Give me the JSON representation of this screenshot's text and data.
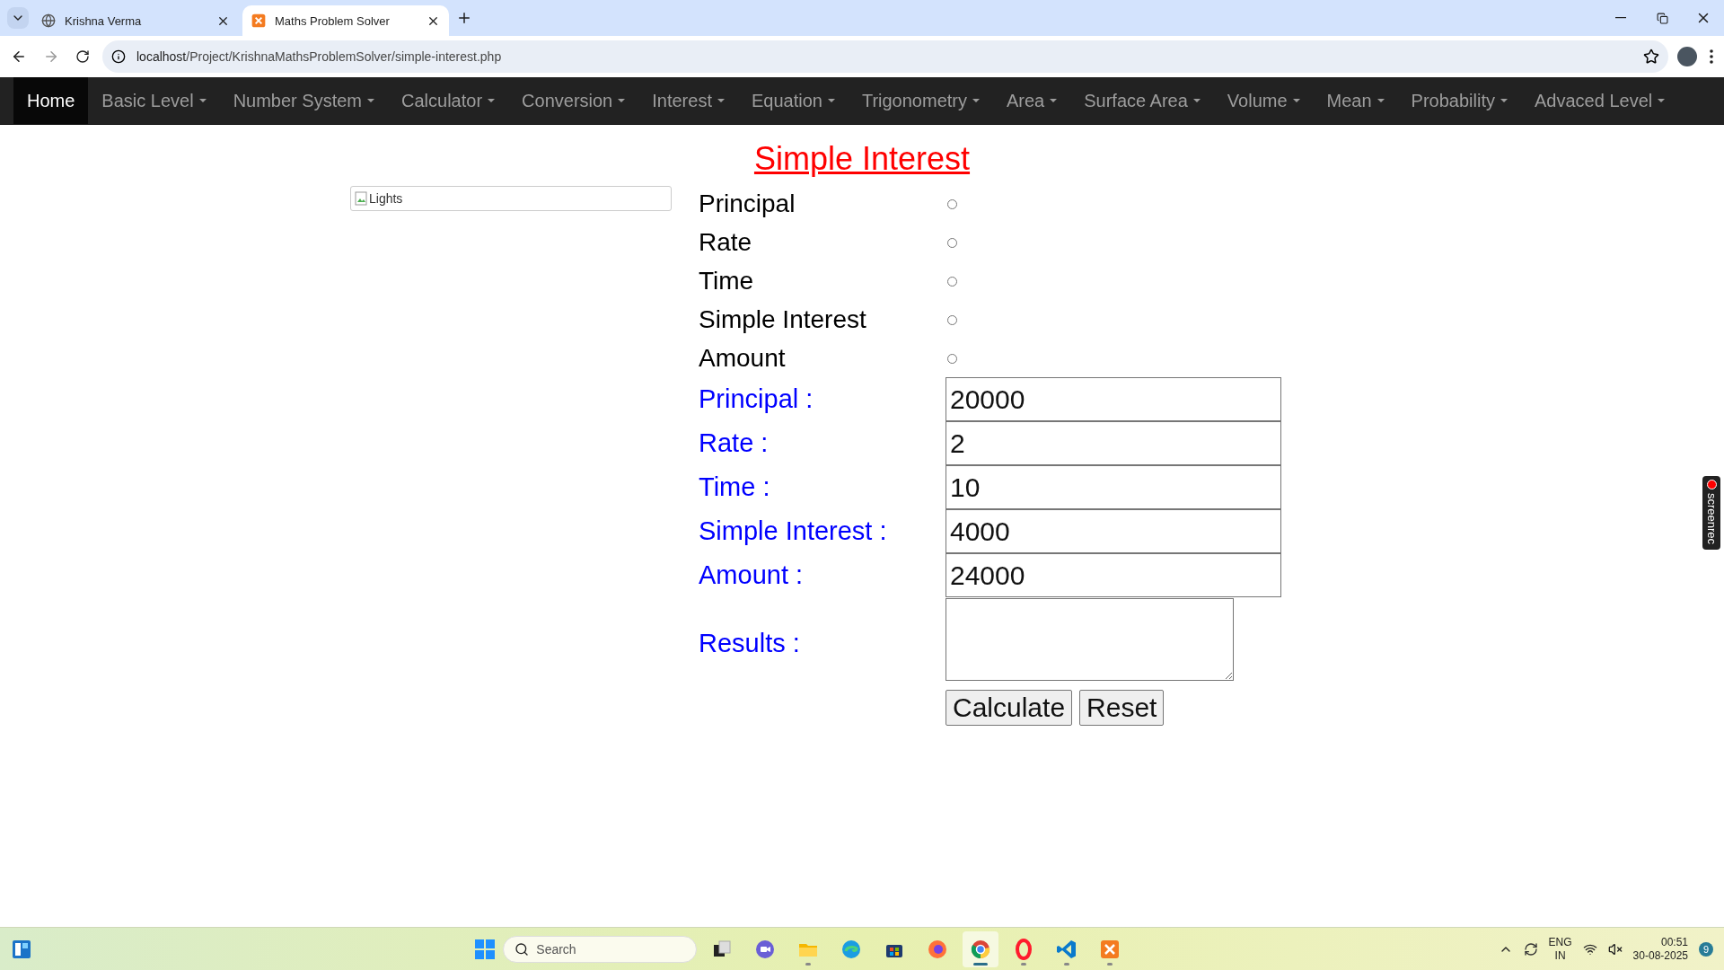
{
  "browser": {
    "tabs": [
      {
        "title": "Krishna Verma",
        "selected": false
      },
      {
        "title": "Maths Problem Solver",
        "selected": true
      }
    ],
    "url": {
      "host": "localhost",
      "path": "/Project/KrishnaMathsProblemSolver/simple-interest.php"
    }
  },
  "nav": {
    "items": [
      {
        "label": "Home",
        "selected": true,
        "dropdown": false
      },
      {
        "label": "Basic Level",
        "selected": false,
        "dropdown": true
      },
      {
        "label": "Number System",
        "selected": false,
        "dropdown": true
      },
      {
        "label": "Calculator",
        "selected": false,
        "dropdown": true
      },
      {
        "label": "Conversion",
        "selected": false,
        "dropdown": true
      },
      {
        "label": "Interest",
        "selected": false,
        "dropdown": true
      },
      {
        "label": "Equation",
        "selected": false,
        "dropdown": true
      },
      {
        "label": "Trigonometry",
        "selected": false,
        "dropdown": true
      },
      {
        "label": "Area",
        "selected": false,
        "dropdown": true
      },
      {
        "label": "Surface Area",
        "selected": false,
        "dropdown": true
      },
      {
        "label": "Volume",
        "selected": false,
        "dropdown": true
      },
      {
        "label": "Mean",
        "selected": false,
        "dropdown": true
      },
      {
        "label": "Probability",
        "selected": false,
        "dropdown": true
      },
      {
        "label": "Advaced Level",
        "selected": false,
        "dropdown": true
      }
    ]
  },
  "page": {
    "title": "Simple Interest",
    "image_alt": "Lights",
    "radios": [
      {
        "label": "Principal",
        "selected": false
      },
      {
        "label": "Rate",
        "selected": false
      },
      {
        "label": "Time",
        "selected": false
      },
      {
        "label": "Simple Interest",
        "selected": false
      },
      {
        "label": "Amount",
        "selected": false
      }
    ],
    "fields": [
      {
        "label": "Principal :",
        "value": "20000"
      },
      {
        "label": "Rate :",
        "value": "2"
      },
      {
        "label": "Time :",
        "value": "10"
      },
      {
        "label": "Simple Interest :",
        "value": "4000"
      },
      {
        "label": "Amount :",
        "value": "24000"
      }
    ],
    "results": {
      "label": "Results :"
    },
    "buttons": [
      "Calculate",
      "Reset"
    ]
  },
  "screenrec": {
    "label": "screenrec"
  },
  "taskbar": {
    "search": {
      "placeholder": "Search"
    },
    "apps": [
      {
        "kind": "taskview",
        "running": false,
        "active": false
      },
      {
        "kind": "meet",
        "running": false,
        "active": false
      },
      {
        "kind": "explorer",
        "running": true,
        "active": false
      },
      {
        "kind": "edge",
        "running": false,
        "active": false
      },
      {
        "kind": "store",
        "running": false,
        "active": false
      },
      {
        "kind": "firefox",
        "running": false,
        "active": false
      },
      {
        "kind": "chrome",
        "running": true,
        "active": true
      },
      {
        "kind": "opera",
        "running": true,
        "active": false
      },
      {
        "kind": "vscode",
        "running": true,
        "active": false
      },
      {
        "kind": "xampp",
        "running": true,
        "active": false
      }
    ],
    "language": [
      "ENG",
      "IN"
    ],
    "time": "00:51",
    "date": "30-08-2025",
    "notifications": "9"
  }
}
